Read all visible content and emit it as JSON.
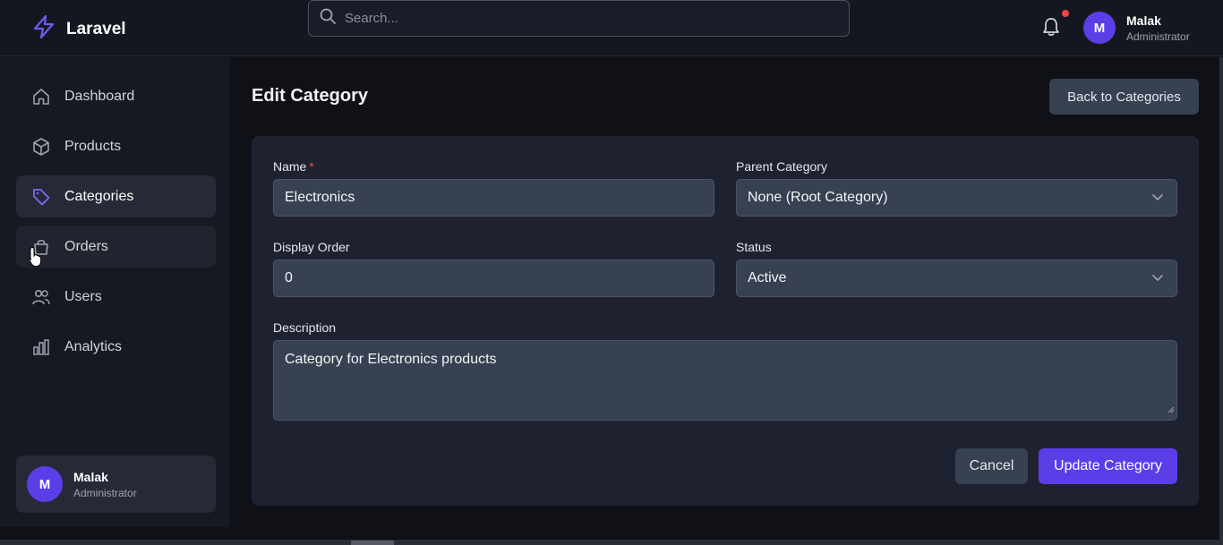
{
  "header": {
    "brand": "Laravel",
    "search_placeholder": "Search...",
    "user": {
      "initial": "M",
      "name": "Malak",
      "role": "Administrator"
    }
  },
  "sidebar": {
    "items": [
      {
        "label": "Dashboard",
        "icon": "home-icon"
      },
      {
        "label": "Products",
        "icon": "box-icon"
      },
      {
        "label": "Categories",
        "icon": "tag-icon",
        "active": true
      },
      {
        "label": "Orders",
        "icon": "bag-icon"
      },
      {
        "label": "Users",
        "icon": "users-icon"
      },
      {
        "label": "Analytics",
        "icon": "bar-chart-icon"
      }
    ],
    "user": {
      "initial": "M",
      "name": "Malak",
      "role": "Administrator"
    }
  },
  "main": {
    "title": "Edit Category",
    "back_label": "Back to Categories",
    "form": {
      "name_label": "Name",
      "name_required_mark": "*",
      "name_value": "Electronics",
      "parent_label": "Parent Category",
      "parent_value": "None (Root Category)",
      "order_label": "Display Order",
      "order_value": "0",
      "status_label": "Status",
      "status_value": "Active",
      "description_label": "Description",
      "description_value": "Category for Electronics products",
      "cancel_label": "Cancel",
      "submit_label": "Update Category"
    }
  },
  "colors": {
    "accent": "#5b3ee8",
    "notification_dot": "#ef4444",
    "required": "#ef4444"
  }
}
